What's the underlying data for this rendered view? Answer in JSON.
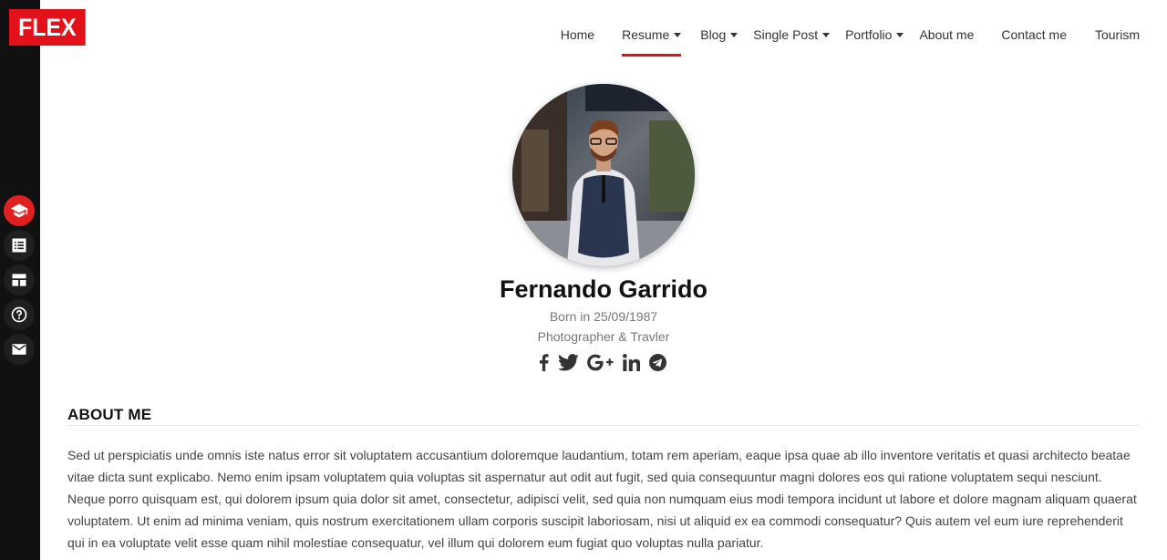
{
  "logo": {
    "text": "FLEX",
    "color": "#e3111a"
  },
  "nav": {
    "items": [
      {
        "label": "Home",
        "has_dropdown": false,
        "active": false
      },
      {
        "label": "Resume",
        "has_dropdown": true,
        "active": true
      },
      {
        "label": "Blog",
        "has_dropdown": true,
        "active": false
      },
      {
        "label": "Single Post",
        "has_dropdown": true,
        "active": false
      },
      {
        "label": "Portfolio",
        "has_dropdown": true,
        "active": false
      },
      {
        "label": "About me",
        "has_dropdown": false,
        "active": false
      },
      {
        "label": "Contact me",
        "has_dropdown": false,
        "active": false
      },
      {
        "label": "Tourism",
        "has_dropdown": false,
        "active": false
      }
    ],
    "accent": "#e3111a"
  },
  "sidebar": {
    "icons": [
      {
        "name": "graduation-cap-icon",
        "active": true
      },
      {
        "name": "list-icon",
        "active": false
      },
      {
        "name": "dashboard-icon",
        "active": false
      },
      {
        "name": "help-icon",
        "active": false
      },
      {
        "name": "mail-icon",
        "active": false
      }
    ]
  },
  "profile": {
    "name": "Fernando Garrido",
    "born": "Born in 25/09/1987",
    "profession": "Photographer & Travler",
    "socials": [
      "facebook-icon",
      "twitter-icon",
      "google-plus-icon",
      "linkedin-icon",
      "telegram-icon"
    ]
  },
  "about": {
    "title": "ABOUT ME",
    "text": "Sed ut perspiciatis unde omnis iste natus error sit voluptatem accusantium doloremque laudantium, totam rem aperiam, eaque ipsa quae ab illo inventore veritatis et quasi architecto beatae vitae dicta sunt explicabo. Nemo enim ipsam voluptatem quia voluptas sit aspernatur aut odit aut fugit, sed quia consequuntur magni dolores eos qui ratione voluptatem sequi nesciunt. Neque porro quisquam est, qui dolorem ipsum quia dolor sit amet, consectetur, adipisci velit, sed quia non numquam eius modi tempora incidunt ut labore et dolore magnam aliquam quaerat voluptatem. Ut enim ad minima veniam, quis nostrum exercitationem ullam corporis suscipit laboriosam, nisi ut aliquid ex ea commodi consequatur? Quis autem vel eum iure reprehenderit qui in ea voluptate velit esse quam nihil molestiae consequatur, vel illum qui dolorem eum fugiat quo voluptas nulla pariatur."
  }
}
